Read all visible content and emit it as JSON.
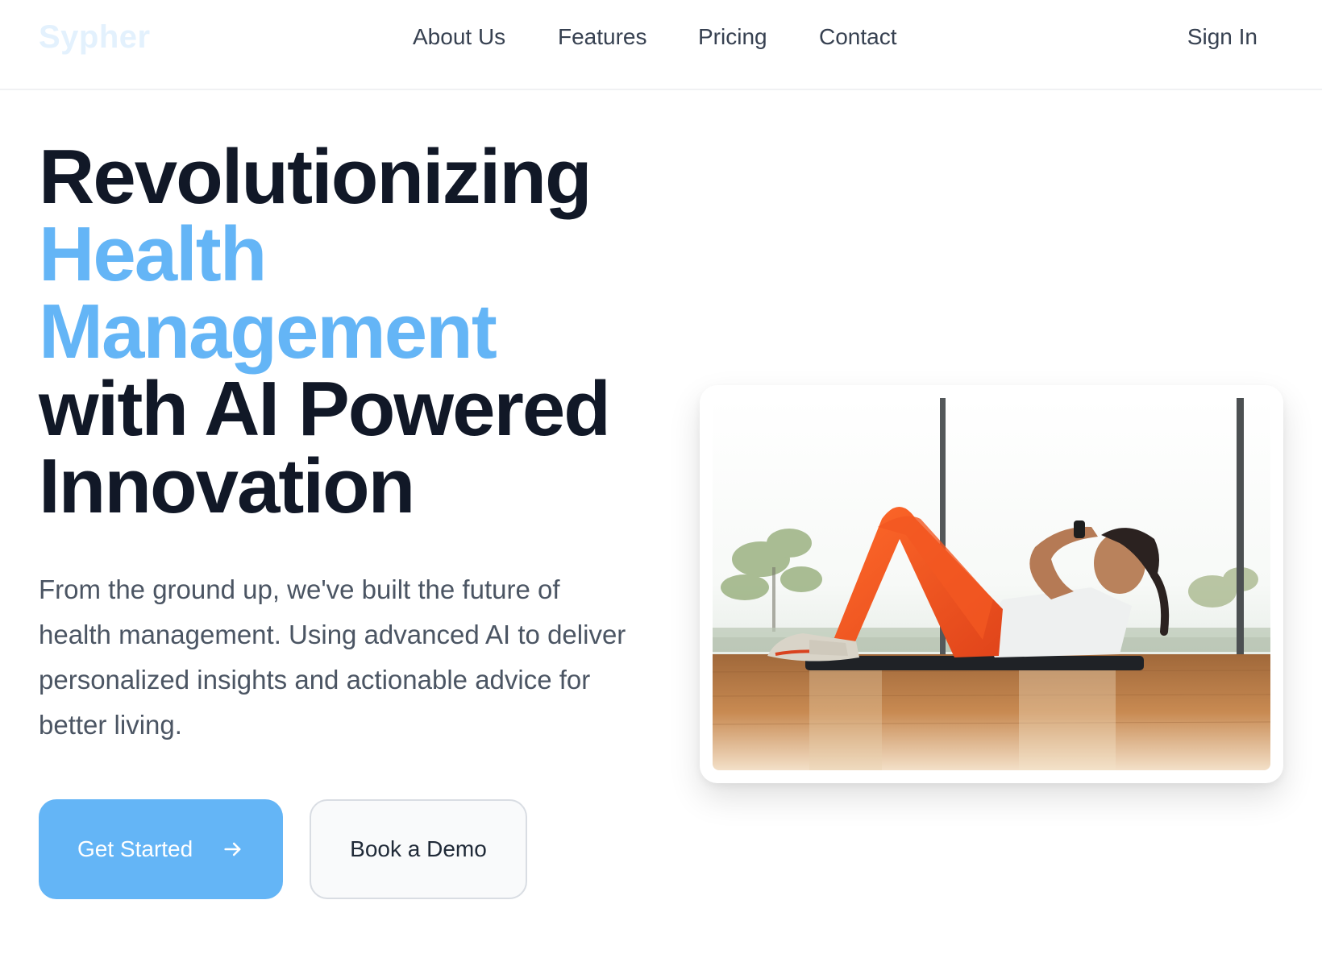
{
  "brand": {
    "logo_text": "Sypher"
  },
  "nav": {
    "links": [
      "About Us",
      "Features",
      "Pricing",
      "Contact"
    ],
    "sign_in": "Sign In"
  },
  "hero": {
    "title_lines": [
      "Revolutionizing",
      "Health",
      "Management",
      "with AI Powered",
      "Innovation"
    ],
    "description": "From the ground up, we've built the future of health management. Using advanced AI to deliver personalized insights and actionable advice for better living.",
    "primary_button": "Get Started",
    "secondary_button": "Book a Demo",
    "image_alt_icon": "woman-doing-crunches-photo"
  },
  "colors": {
    "accent": "#64b5f6",
    "title": "#111827",
    "body_text": "#4b5563",
    "logo": "#e3f1fd"
  }
}
